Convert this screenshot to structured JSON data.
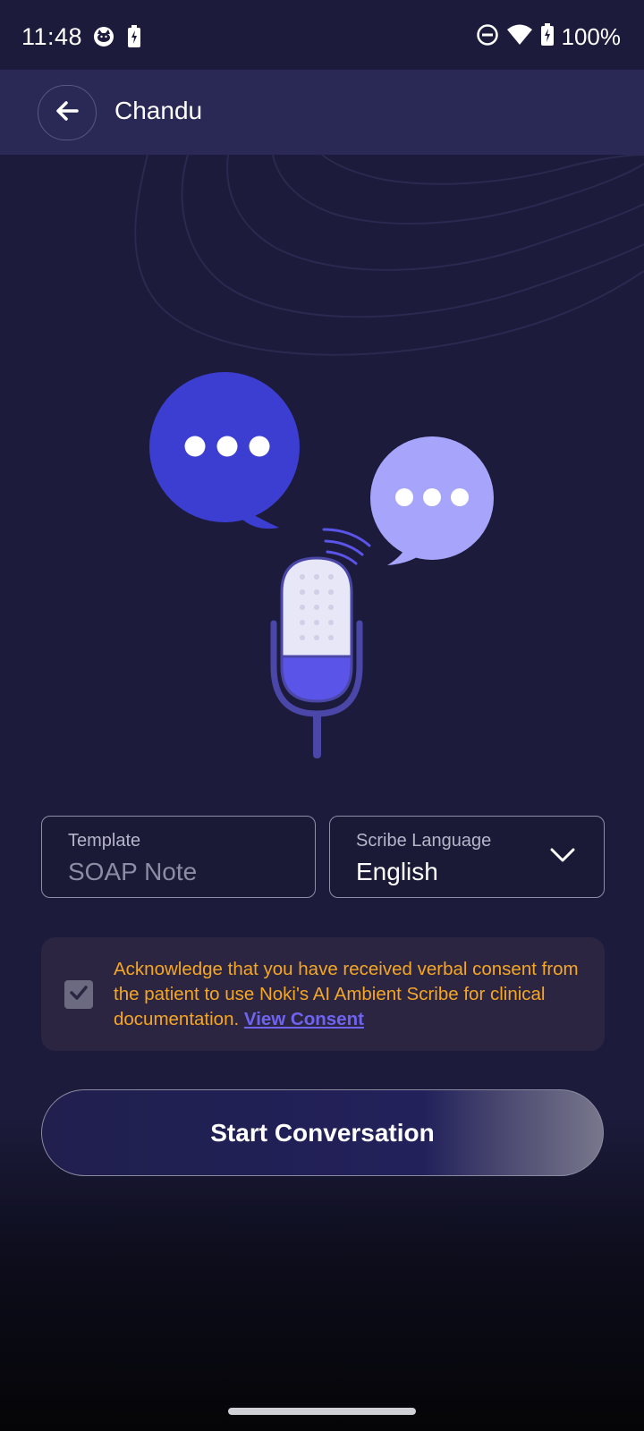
{
  "status_bar": {
    "time": "11:48",
    "battery": "100%",
    "icons": [
      "cat-notification-icon",
      "battery-saver-icon",
      "do-not-disturb-icon",
      "wifi-icon",
      "battery-charging-icon"
    ]
  },
  "header": {
    "title": "Chandu",
    "back_icon": "arrow-left-icon"
  },
  "illustration": {
    "icons": [
      "chat-bubble-icon",
      "microphone-icon"
    ],
    "colors": {
      "bubble_primary": "#3b3ed0",
      "bubble_secondary": "#a6a5fb",
      "mic_body": "#e7e7f7",
      "mic_accent": "#5b54e8",
      "mic_stand": "#4a47a8"
    }
  },
  "form": {
    "template": {
      "label": "Template",
      "value": "SOAP Note"
    },
    "language": {
      "label": "Scribe Language",
      "value": "English"
    }
  },
  "consent": {
    "checked": true,
    "text": "Acknowledge that you have received verbal consent from the patient to use Noki's AI Ambient Scribe for clinical documentation.",
    "link": "View Consent"
  },
  "actions": {
    "start": "Start Conversation"
  },
  "colors": {
    "background": "#1c1b3b",
    "header": "#2a2855",
    "consent_text": "#f5a623",
    "link": "#6e64f0"
  }
}
